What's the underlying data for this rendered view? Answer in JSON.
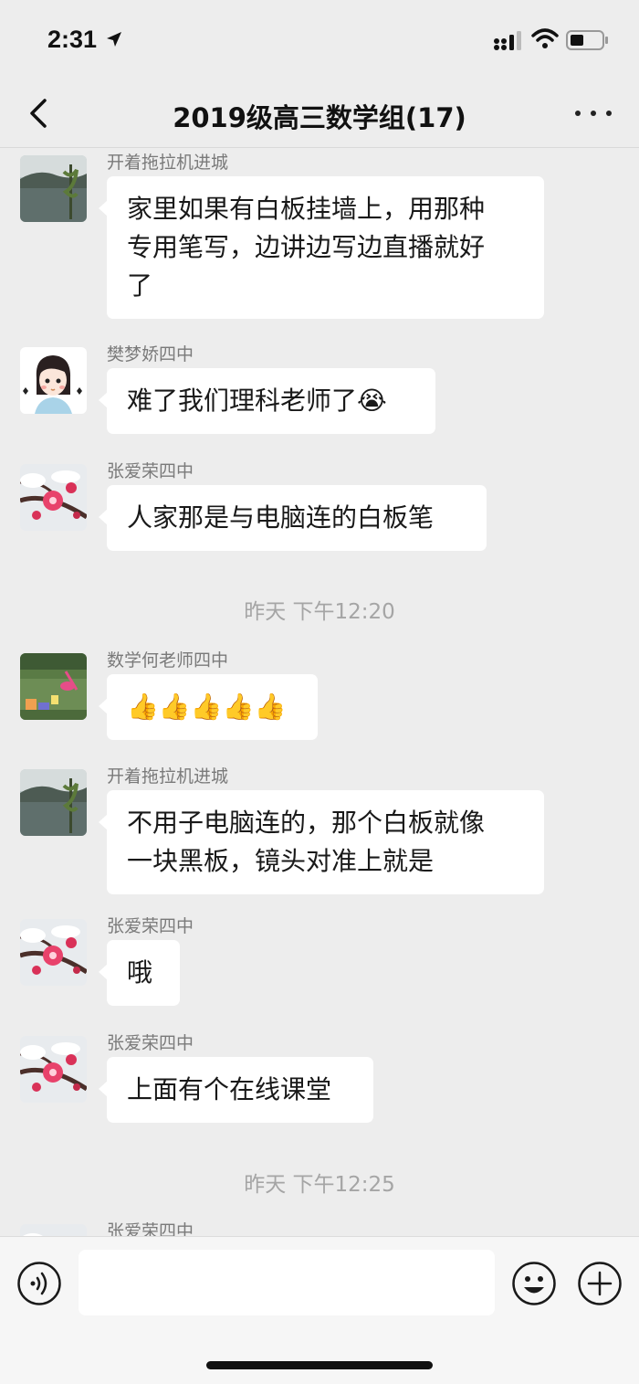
{
  "status_bar": {
    "time": "2:31"
  },
  "nav": {
    "title": "2019级高三数学组(17)"
  },
  "messages": [
    {
      "sender": "开着拖拉机进城",
      "text": [
        "家里如果有白板挂墙上，用那种",
        "专用笔写，边讲边写边直播就好",
        "了"
      ],
      "avatar": "lake-avatar"
    },
    {
      "sender": "樊梦娇四中",
      "text": [
        "难了我们理科老师了"
      ],
      "emoji": "😭",
      "avatar": "girl-cartoon-avatar"
    },
    {
      "sender": "张爱荣四中",
      "text": [
        "人家那是与电脑连的白板笔"
      ],
      "avatar": "plum-blossom-avatar"
    },
    {
      "sender": "数学何老师四中",
      "text": [
        ""
      ],
      "emoji": "👍👍👍👍👍",
      "avatar": "garden-avatar"
    },
    {
      "sender": "开着拖拉机进城",
      "text": [
        "不用子电脑连的，那个白板就像",
        "一块黑板，镜头对准上就是"
      ],
      "avatar": "lake-avatar"
    },
    {
      "sender": "张爱荣四中",
      "text": [
        "哦"
      ],
      "avatar": "plum-blossom-avatar"
    },
    {
      "sender": "张爱荣四中",
      "text": [
        "上面有个在线课堂"
      ],
      "avatar": "plum-blossom-avatar"
    },
    {
      "sender": "张爱荣四中",
      "text": [],
      "avatar": "plum-blossom-avatar"
    }
  ],
  "timestamps": [
    "昨天 下午12:20",
    "昨天 下午12:25"
  ],
  "input": {
    "placeholder": ""
  },
  "icons": {
    "back": "chevron-left-icon",
    "more": "more-dots-icon",
    "voice": "voice-icon",
    "emoji": "emoji-icon",
    "plus": "plus-icon"
  },
  "colors": {
    "background": "#ededed",
    "bubble": "#ffffff",
    "timestamp": "#a5a5a5"
  }
}
